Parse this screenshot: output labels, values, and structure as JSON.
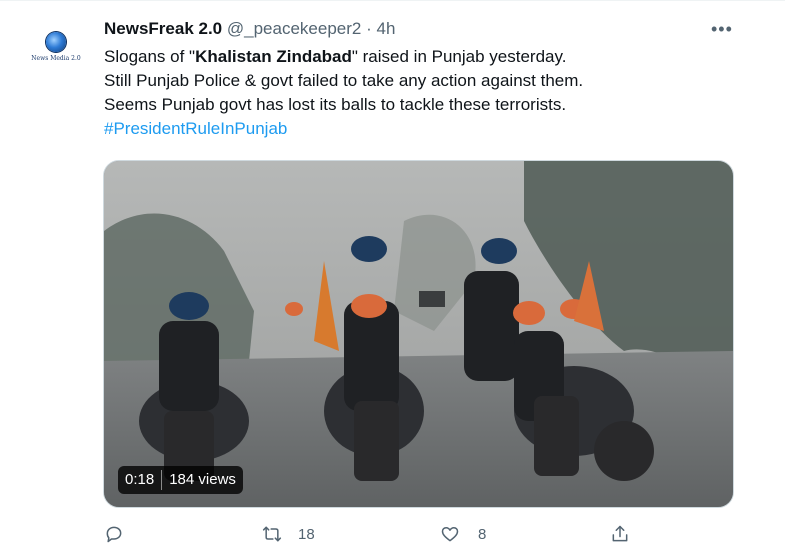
{
  "tweet": {
    "avatar_label": "News Media 2.0",
    "display_name": "NewsFreak 2.0",
    "handle": "@_peacekeeper2",
    "separator": "·",
    "time": "4h",
    "more_label": "•••",
    "text": {
      "line1_before": "Slogans of \"",
      "line1_bold": "Khalistan Zindabad",
      "line1_after": "\" raised in Punjab yesterday.",
      "line2": "Still Punjab Police & govt failed to take any action against them.",
      "line3": "Seems Punjab govt has lost its balls to tackle these terrorists.",
      "hashtag": "#PresidentRuleInPunjab"
    },
    "video": {
      "duration": "0:18",
      "views": "184 views"
    },
    "actions": {
      "reply_count": "",
      "retweet_count": "18",
      "like_count": "8",
      "share_count": ""
    }
  },
  "colors": {
    "text_primary": "#0f1419",
    "text_secondary": "#536471",
    "link": "#1d9bf0",
    "border": "#cfd9de"
  },
  "icons": [
    "reply-icon",
    "retweet-icon",
    "like-icon",
    "share-icon",
    "more-icon"
  ]
}
